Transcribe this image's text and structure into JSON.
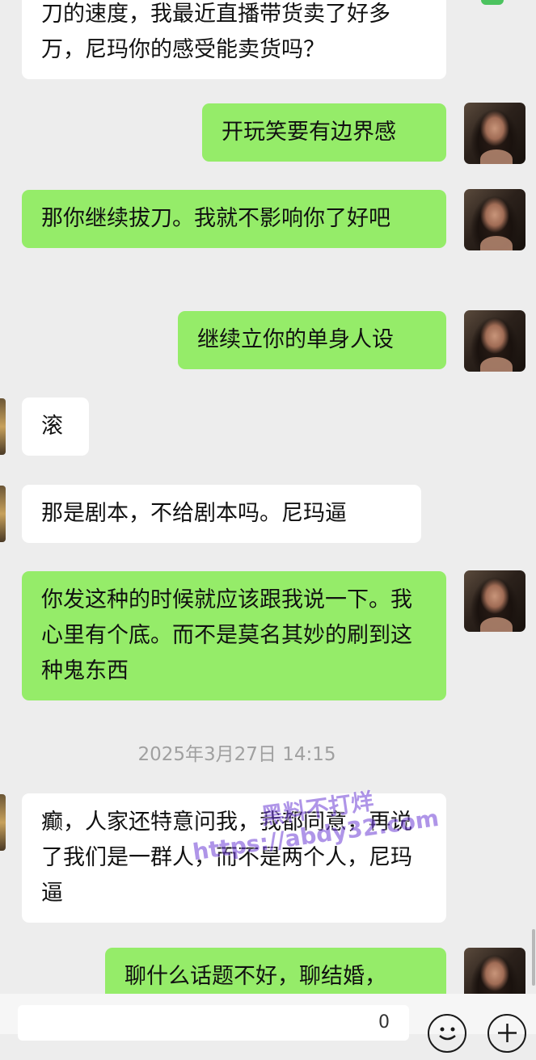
{
  "messages": [
    {
      "side": "in",
      "text": "刀的速度，我最近直播带货卖了好多万，尼玛你的感受能卖货吗？"
    },
    {
      "side": "out",
      "text": "开玩笑要有边界感"
    },
    {
      "side": "out",
      "text": "那你继续拔刀。我就不影响你了好吧"
    },
    {
      "side": "out",
      "text": "继续立你的单身人设"
    },
    {
      "side": "in",
      "text": "滚"
    },
    {
      "side": "in",
      "text": "那是剧本，不给剧本吗。尼玛逼"
    },
    {
      "side": "out",
      "text": "你发这种的时候就应该跟我说一下。我心里有个底。而不是莫名其妙的刷到这种鬼东西"
    },
    {
      "side": "in",
      "text": "癫，人家还特意问我，我都同意，再说了我们是一群人，而不是两个人，尼玛逼"
    },
    {
      "side": "out",
      "text": "聊什么话题不好，聊结婚，"
    }
  ],
  "timestamp": "2025年3月27日 14:15",
  "watermark": {
    "line1": "黑料不打烊",
    "line2": "https://abdy32.com"
  },
  "input_bar": {
    "value": "0",
    "emoji_icon": "emoji-icon",
    "plus_icon": "plus-icon"
  },
  "colors": {
    "outgoing_bubble": "#95ec69",
    "incoming_bubble": "#ffffff",
    "background": "#ededed",
    "watermark": "#6f3fd6"
  }
}
